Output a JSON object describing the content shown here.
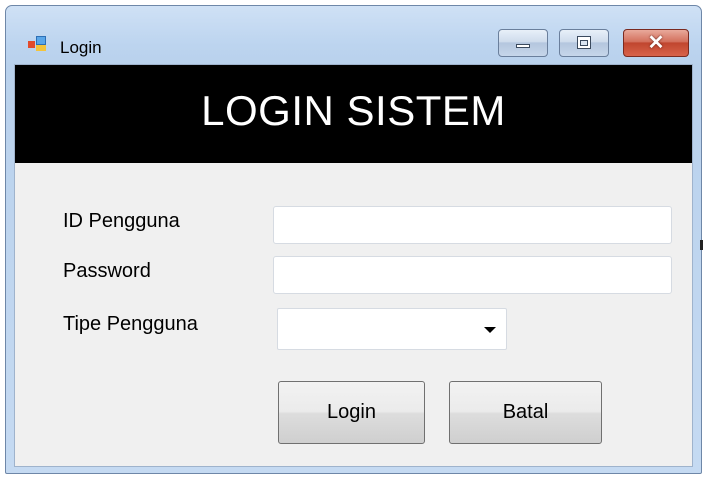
{
  "window": {
    "title": "Login",
    "icon": "windows-form-icon",
    "controls": [
      "minimize-icon",
      "maximize-icon",
      "close-icon"
    ]
  },
  "banner": {
    "title": "LOGIN SISTEM"
  },
  "form": {
    "id_label": "ID Pengguna",
    "id_value": "",
    "password_label": "Password",
    "password_value": "",
    "type_label": "Tipe Pengguna",
    "type_selected": ""
  },
  "buttons": {
    "login": "Login",
    "cancel": "Batal"
  },
  "colors": {
    "banner_bg": "#000000",
    "banner_text": "#ffffff",
    "client_bg": "#f0f0f0",
    "close_button": "#c0462f"
  }
}
